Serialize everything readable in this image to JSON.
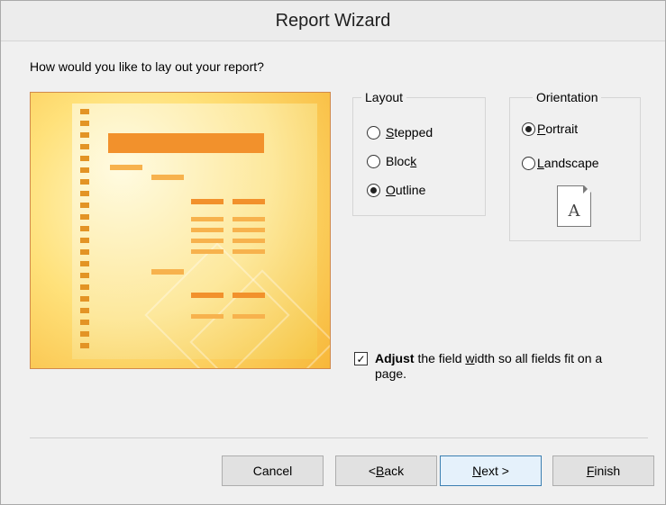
{
  "window": {
    "title": "Report Wizard"
  },
  "prompt": "How would you like to lay out your report?",
  "layout_group": {
    "legend": "Layout",
    "options": [
      {
        "pre": "",
        "accel": "S",
        "post": "tepped",
        "checked": false
      },
      {
        "pre": "Bloc",
        "accel": "k",
        "post": "",
        "checked": false
      },
      {
        "pre": "",
        "accel": "O",
        "post": "utline",
        "checked": true
      }
    ]
  },
  "orientation_group": {
    "legend": "Orientation",
    "options": [
      {
        "pre": "",
        "accel": "P",
        "post": "ortrait",
        "checked": true
      },
      {
        "pre": "",
        "accel": "L",
        "post": "andscape",
        "checked": false
      }
    ],
    "page_icon_letter": "A"
  },
  "adjust": {
    "checked": true,
    "check_glyph": "✓",
    "bold_part": "Adjust",
    "text_pre": " the field ",
    "accel": "w",
    "text_post": "idth so all fields fit on a page."
  },
  "buttons": {
    "cancel": {
      "pre": "Cancel",
      "accel": "",
      "post": ""
    },
    "back": {
      "pre": "< ",
      "accel": "B",
      "post": "ack"
    },
    "next": {
      "pre": "",
      "accel": "N",
      "post": "ext >"
    },
    "finish": {
      "pre": "",
      "accel": "F",
      "post": "inish"
    }
  },
  "colors": {
    "preview_orange": "#f2912c",
    "preview_yellow": "#ffe17a",
    "default_button_border": "#3c7fb1"
  }
}
